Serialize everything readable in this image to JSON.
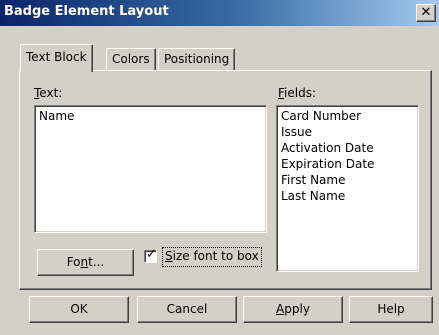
{
  "window": {
    "title": "Badge Element Layout",
    "close_label": "✕"
  },
  "tabs": [
    {
      "label": "Text Block",
      "active": true
    },
    {
      "label": "Colors",
      "active": false
    },
    {
      "label": "Positioning",
      "active": false
    }
  ],
  "text_section": {
    "label_first": "T",
    "label_rest": "ext:",
    "value": "Name"
  },
  "fields_section": {
    "label_first": "F",
    "label_rest": "ields:",
    "items": [
      "Card Number",
      "Issue",
      "Activation Date",
      "Expiration Date",
      "First Name",
      "Last Name"
    ]
  },
  "font_button": {
    "pre": "Fo",
    "accel": "n",
    "post": "t..."
  },
  "size_checkbox": {
    "checked": true,
    "accel": "S",
    "rest": "ize font to box"
  },
  "buttons": {
    "ok": "OK",
    "cancel": "Cancel",
    "apply_accel": "A",
    "apply_rest": "pply",
    "help": "Help"
  }
}
